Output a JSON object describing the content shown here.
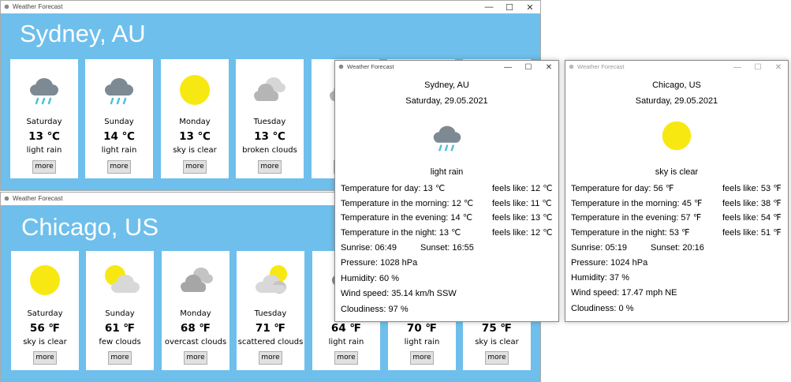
{
  "windows": {
    "main": {
      "title": "Weather Forecast",
      "sydney": {
        "city": "Sydney, AU",
        "cards": [
          {
            "day": "Saturday",
            "temp": "13 ℃",
            "desc": "light rain",
            "icon": "rain-cloud-icon",
            "more": "more"
          },
          {
            "day": "Sunday",
            "temp": "14 ℃",
            "desc": "light rain",
            "icon": "rain-cloud-icon",
            "more": "more"
          },
          {
            "day": "Monday",
            "temp": "13 ℃",
            "desc": "sky is clear",
            "icon": "sun-icon",
            "more": "more"
          },
          {
            "day": "Tuesday",
            "temp": "13 ℃",
            "desc": "broken clouds",
            "icon": "broken-clouds-icon",
            "more": "more"
          },
          {
            "day": "We",
            "temp": "1",
            "desc": "overc",
            "icon": "cloud-icon",
            "more": "more"
          }
        ]
      }
    },
    "second": {
      "title": "Weather Forecast",
      "chicago": {
        "city": "Chicago, US",
        "cards": [
          {
            "day": "Saturday",
            "temp": "56 ℉",
            "desc": "sky is clear",
            "icon": "sun-icon",
            "more": "more"
          },
          {
            "day": "Sunday",
            "temp": "61 ℉",
            "desc": "few clouds",
            "icon": "few-clouds-icon",
            "more": "more"
          },
          {
            "day": "Monday",
            "temp": "68 ℉",
            "desc": "overcast clouds",
            "icon": "overcast-clouds-icon",
            "more": "more"
          },
          {
            "day": "Tuesday",
            "temp": "71 ℉",
            "desc": "scattered clouds",
            "icon": "scattered-clouds-icon",
            "more": "more"
          },
          {
            "day": "We",
            "temp": "64 ℉",
            "desc": "light rain",
            "icon": "rain-cloud-icon",
            "more": "more"
          },
          {
            "day": "",
            "temp": "70 ℉",
            "desc": "light rain",
            "icon": "",
            "more": "more"
          },
          {
            "day": "",
            "temp": "75 ℉",
            "desc": "sky is clear",
            "icon": "",
            "more": "more"
          }
        ]
      }
    },
    "detail_sydney": {
      "title": "Weather Forecast",
      "city": "Sydney, AU",
      "date": "Saturday, 29.05.2021",
      "icon": "rain-cloud-icon",
      "desc": "light rain",
      "temp_day": "Temperature for day: 13 ℃",
      "feels_day": "feels like: 12 ℃",
      "temp_morning": "Temperature in the morning: 12 ℃",
      "feels_morning": "feels like: 11 ℃",
      "temp_evening": "Temperature in the evening: 14 ℃",
      "feels_evening": "feels like: 13 ℃",
      "temp_night": "Temperature in the night: 13 ℃",
      "feels_night": "feels like: 12 ℃",
      "sunrise": "Sunrise: 06:49",
      "sunset": "Sunset: 16:55",
      "pressure": "Pressure: 1028 hPa",
      "humidity": "Humidity: 60 %",
      "wind": "Wind speed: 35.14 km/h SSW",
      "cloudiness": "Cloudiness: 97 %"
    },
    "detail_chicago": {
      "title": "Weather Forecast",
      "city": "Chicago, US",
      "date": "Saturday, 29.05.2021",
      "icon": "sun-icon",
      "desc": "sky is clear",
      "temp_day": "Temperature for day: 56 ℉",
      "feels_day": "feels like: 53 ℉",
      "temp_morning": "Temperature in the morning: 45 ℉",
      "feels_morning": "feels like: 38 ℉",
      "temp_evening": "Temperature in the evening: 57 ℉",
      "feels_evening": "feels like: 54 ℉",
      "temp_night": "Temperature in the night: 53 ℉",
      "feels_night": "feels like: 51 ℉",
      "sunrise": "Sunrise: 05:19",
      "sunset": "Sunset: 20:16",
      "pressure": "Pressure: 1024 hPa",
      "humidity": "Humidity: 37 %",
      "wind": "Wind speed: 17.47 mph NE",
      "cloudiness": "Cloudiness: 0 %"
    }
  },
  "controls": {
    "minimize": "—",
    "maximize": "☐",
    "close": "✕"
  },
  "colors": {
    "panel": "#6ebfeb",
    "sun": "#f7e812",
    "cloud_dark": "#7d8a93",
    "cloud_light": "#cfcfcf",
    "rain": "#4fc0d6"
  }
}
